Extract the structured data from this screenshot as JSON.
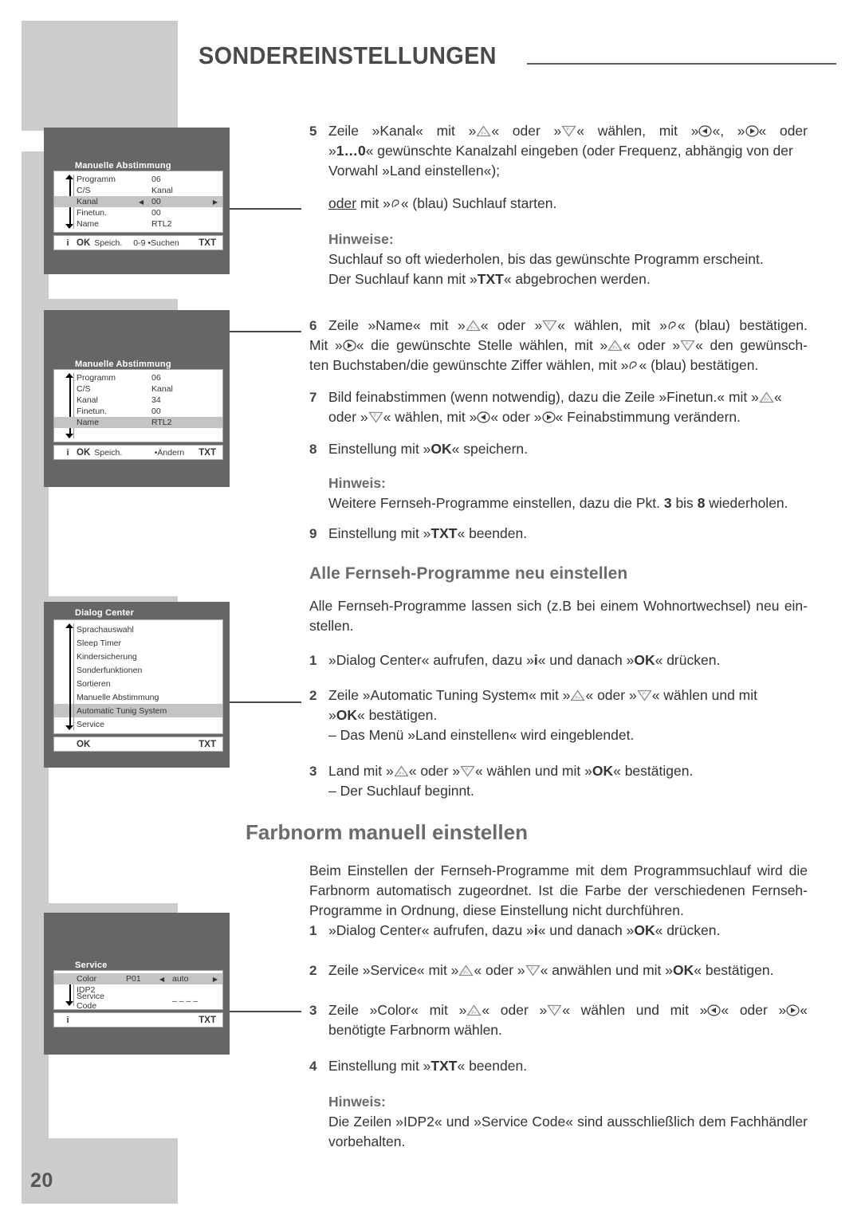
{
  "header": {
    "title": "SONDEREINSTELLUNGEN"
  },
  "page": {
    "number": "20"
  },
  "tv_screens": [
    {
      "name": "manuelle-abstimmung-kanal",
      "title": "Manuelle Abstimmung",
      "rows": [
        {
          "label": "Programm",
          "left_arrow": "",
          "value": "06",
          "right_arrow": "",
          "highlight": false
        },
        {
          "label": "C/S",
          "left_arrow": "",
          "value": "Kanal",
          "right_arrow": "",
          "highlight": false
        },
        {
          "label": "Kanal",
          "left_arrow": "◀",
          "value": "00",
          "right_arrow": "▶",
          "highlight": true
        },
        {
          "label": "Finetun.",
          "left_arrow": "",
          "value": "00",
          "right_arrow": "",
          "highlight": false
        },
        {
          "label": "Name",
          "left_arrow": "",
          "value": "RTL2",
          "right_arrow": "",
          "highlight": false
        }
      ],
      "footer": {
        "info": "i",
        "ok": "OK",
        "ok_text": "Speich.",
        "middle": "0-9  •Suchen",
        "txt": "TXT"
      }
    },
    {
      "name": "manuelle-abstimmung-name",
      "title": "Manuelle Abstimmung",
      "rows": [
        {
          "label": "Programm",
          "left_arrow": "",
          "value": "06",
          "right_arrow": "",
          "highlight": false
        },
        {
          "label": "C/S",
          "left_arrow": "",
          "value": "Kanal",
          "right_arrow": "",
          "highlight": false
        },
        {
          "label": "Kanal",
          "left_arrow": "",
          "value": "34",
          "right_arrow": "",
          "highlight": false
        },
        {
          "label": "Finetun.",
          "left_arrow": "",
          "value": "00",
          "right_arrow": "",
          "highlight": false
        },
        {
          "label": "Name",
          "left_arrow": "",
          "value": "RTL2",
          "right_arrow": "",
          "highlight": true
        }
      ],
      "footer": {
        "info": "i",
        "ok": "OK",
        "ok_text": "Speich.",
        "middle": "•Ändern",
        "txt": "TXT"
      }
    },
    {
      "name": "dialog-center",
      "title": "Dialog Center",
      "items": [
        {
          "label": "Sprachauswahl",
          "highlight": false
        },
        {
          "label": "Sleep Timer",
          "highlight": false
        },
        {
          "label": "Kindersicherung",
          "highlight": false
        },
        {
          "label": "Sonderfunktionen",
          "highlight": false
        },
        {
          "label": "Sortieren",
          "highlight": false
        },
        {
          "label": "Manuelle Abstimmung",
          "highlight": false
        },
        {
          "label": "Automatic Tunig System",
          "highlight": true
        },
        {
          "label": "Service",
          "highlight": false
        }
      ],
      "footer": {
        "ok": "OK",
        "txt": "TXT"
      }
    },
    {
      "name": "service",
      "title": "Service",
      "rows": [
        {
          "label": "Color",
          "mid": "P01",
          "left_arrow": "◀",
          "value": "auto",
          "right_arrow": "▶",
          "highlight": true
        },
        {
          "label": "IDP2",
          "mid": "",
          "left_arrow": "",
          "value": "",
          "right_arrow": "",
          "highlight": false
        },
        {
          "label": "Service Code",
          "mid": "",
          "left_arrow": "",
          "value": "– – – –",
          "right_arrow": "",
          "highlight": false
        }
      ],
      "footer": {
        "info": "i",
        "txt": "TXT"
      }
    }
  ],
  "steps": {
    "s5": {
      "num": "5",
      "l1a": "Zeile »Kanal« mit »",
      "l1b": "« oder »",
      "l1c": "« wählen, mit »",
      "l1d": "«, »",
      "l1e": "« oder",
      "l2a": "»",
      "l2b": "1…0",
      "l2c": "« gewünschte Kanalzahl eingeben (oder Frequenz, abhängig von der",
      "l3": "Vorwahl »Land einstellen«);"
    },
    "oder_line": {
      "oder": "oder",
      "a": " mit »",
      "b": "« (blau) Suchlauf starten."
    },
    "hinweise1": {
      "title": "Hinweise:",
      "l1": "Suchlauf so oft wiederholen, bis das gewünschte Programm erscheint.",
      "l2a": "Der Suchlauf kann mit »",
      "l2b": "TXT",
      "l2c": "« abgebrochen werden."
    },
    "s6": {
      "num": "6",
      "l1a": "Zeile »Name« mit »",
      "l1b": "« oder »",
      "l1c": "« wählen, mit »",
      "l1d": "« (blau) bestätigen.",
      "l2a": "Mit »",
      "l2b": "« die gewünschte Stelle wählen, mit »",
      "l2c": "« oder »",
      "l2d": "« den gewünsch-",
      "l3a": "ten Buchstaben/die gewünschte Ziffer wählen, mit »",
      "l3b": "« (blau) bestätigen."
    },
    "s7": {
      "num": "7",
      "l1a": "Bild feinabstimmen (wenn notwendig), dazu die Zeile »Finetun.« mit »",
      "l1b": "«",
      "l2a": "oder »",
      "l2b": "« wählen, mit »",
      "l2c": "« oder »",
      "l2d": "« Feinabstimmung verändern."
    },
    "s8": {
      "num": "8",
      "a": "Einstellung mit »",
      "b": "OK",
      "c": "« speichern."
    },
    "hinweis2": {
      "title": "Hinweis:",
      "a": "Weitere Fernseh-Programme einstellen, dazu die Pkt. ",
      "n1": "3",
      "b": " bis ",
      "n2": "8",
      "c": " wiederholen."
    },
    "s9": {
      "num": "9",
      "a": "Einstellung mit »",
      "b": "TXT",
      "c": "« beenden."
    }
  },
  "section_alle": {
    "heading": "Alle Fernseh-Programme neu einstellen",
    "intro_l1": "Alle Fernseh-Programme lassen sich (z.B bei einem Wohnortwechsel) neu ein-",
    "intro_l2": "stellen.",
    "s1": {
      "num": "1",
      "a": "»Dialog Center« aufrufen, dazu »",
      "b": "i",
      "c": "« und danach »",
      "d": "OK",
      "e": "« drücken."
    },
    "s2": {
      "num": "2",
      "l1a": "Zeile »Automatic Tuning System« mit »",
      "l1b": "« oder »",
      "l1c": "« wählen und mit",
      "l2a": "»",
      "l2b": "OK",
      "l2c": "« bestätigen.",
      "l3": "– Das Menü »Land einstellen« wird eingeblendet."
    },
    "s3": {
      "num": "3",
      "l1a": "Land mit »",
      "l1b": "« oder »",
      "l1c": "« wählen und mit »",
      "l1d": "OK",
      "l1e": "« bestätigen.",
      "l2": "– Der Suchlauf beginnt."
    }
  },
  "section_farbnorm": {
    "heading": "Farbnorm manuell einstellen",
    "intro_l1": "Beim Einstellen der Fernseh-Programme mit dem Programmsuchlauf wird die",
    "intro_l2": "Farbnorm automatisch zugeordnet. Ist die Farbe der verschiedenen Fernseh-",
    "intro_l3": "Programme in Ordnung, diese Einstellung nicht durchführen.",
    "s1": {
      "num": "1",
      "a": "»Dialog Center« aufrufen, dazu »",
      "b": "i",
      "c": "« und danach »",
      "d": "OK",
      "e": "« drücken."
    },
    "s2": {
      "num": "2",
      "a": "Zeile »Service« mit »",
      "b": "« oder »",
      "c": "« anwählen und mit »",
      "d": "OK",
      "e": "« bestätigen."
    },
    "s3": {
      "num": "3",
      "l1a": "Zeile »Color« mit »",
      "l1b": "« oder »",
      "l1c": "« wählen und mit »",
      "l1d": "« oder »",
      "l1e": "«",
      "l2": "benötigte Farbnorm wählen."
    },
    "s4": {
      "num": "4",
      "a": "Einstellung mit »",
      "b": "TXT",
      "c": "« beenden."
    },
    "hinweis": {
      "title": "Hinweis:",
      "l1": "Die Zeilen »IDP2« und »Service Code« sind ausschließlich dem Fachhändler",
      "l2": "vorbehalten."
    }
  },
  "icons": {
    "p_up": "p-plus-triangle-up-icon",
    "p_down": "p-minus-triangle-down-icon",
    "left": "arrow-left-round-icon",
    "right": "arrow-right-round-icon",
    "blue": "blue-button-icon"
  },
  "colors": {
    "band_gray": "#cccccc",
    "tv_dark": "#666666",
    "row_highlight": "#c4c4c4",
    "heading_gray": "#6b6b6b",
    "text": "#333333"
  }
}
